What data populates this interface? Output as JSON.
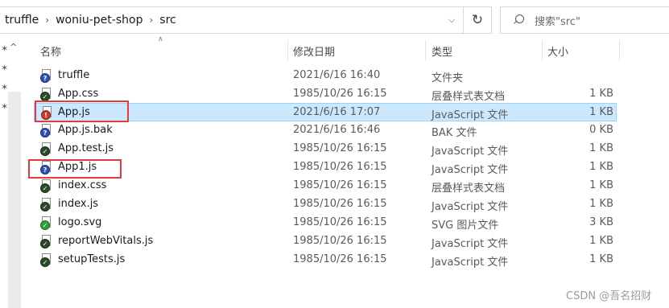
{
  "breadcrumb": [
    "truffle",
    "woniu-pet-shop",
    "src"
  ],
  "search": {
    "placeholder": "搜索\"src\""
  },
  "columns": {
    "name": "名称",
    "date": "修改日期",
    "type": "类型",
    "size": "大小"
  },
  "files": [
    {
      "name": "truffle",
      "date": "2021/6/16 16:40",
      "type": "文件夹",
      "size": "",
      "icon": "folder-question-icon"
    },
    {
      "name": "App.css",
      "date": "1985/10/26 16:15",
      "type": "层叠样式表文档",
      "size": "1 KB",
      "icon": "css-file-icon"
    },
    {
      "name": "App.js",
      "date": "2021/6/16 17:07",
      "type": "JavaScript 文件",
      "size": "1 KB",
      "icon": "js-file-red-icon",
      "selected": true
    },
    {
      "name": "App.js.bak",
      "date": "2021/6/16 16:46",
      "type": "BAK 文件",
      "size": "0 KB",
      "icon": "bak-file-icon"
    },
    {
      "name": "App.test.js",
      "date": "1985/10/26 16:15",
      "type": "JavaScript 文件",
      "size": "1 KB",
      "icon": "js-file-icon"
    },
    {
      "name": "App1.js",
      "date": "1985/10/26 16:15",
      "type": "JavaScript 文件",
      "size": "1 KB",
      "icon": "js-file-blue-icon"
    },
    {
      "name": "index.css",
      "date": "1985/10/26 16:15",
      "type": "层叠样式表文档",
      "size": "1 KB",
      "icon": "css-file-icon"
    },
    {
      "name": "index.js",
      "date": "1985/10/26 16:15",
      "type": "JavaScript 文件",
      "size": "1 KB",
      "icon": "js-file-icon"
    },
    {
      "name": "logo.svg",
      "date": "1985/10/26 16:15",
      "type": "SVG 图片文件",
      "size": "3 KB",
      "icon": "svg-file-icon"
    },
    {
      "name": "reportWebVitals.js",
      "date": "1985/10/26 16:15",
      "type": "JavaScript 文件",
      "size": "1 KB",
      "icon": "js-file-icon"
    },
    {
      "name": "setupTests.js",
      "date": "1985/10/26 16:15",
      "type": "JavaScript 文件",
      "size": "1 KB",
      "icon": "js-file-icon"
    }
  ],
  "watermark": "CSDN @吾名招财",
  "colors": {
    "selection": "#cce8ff",
    "highlight_box": "#e23b3b"
  }
}
